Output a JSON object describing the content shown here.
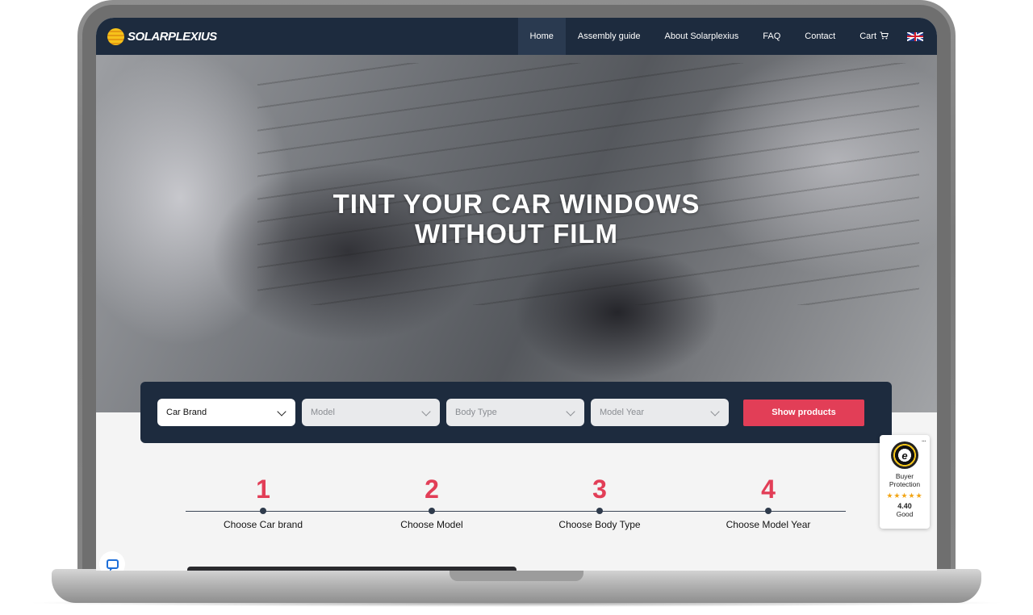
{
  "brand": {
    "name": "SOLARPLEXIUS"
  },
  "nav": {
    "items": [
      {
        "label": "Home",
        "active": true
      },
      {
        "label": "Assembly guide",
        "active": false
      },
      {
        "label": "About Solarplexius",
        "active": false
      },
      {
        "label": "FAQ",
        "active": false
      },
      {
        "label": "Contact",
        "active": false
      },
      {
        "label": "Cart",
        "active": false
      }
    ],
    "cart_icon": "shopping-cart-icon",
    "language_icon": "uk-flag-icon"
  },
  "hero": {
    "title_line1": "TINT YOUR CAR WINDOWS",
    "title_line2": "WITHOUT FILM"
  },
  "filter": {
    "selects": [
      {
        "label": "Car Brand",
        "enabled": true
      },
      {
        "label": "Model",
        "enabled": false
      },
      {
        "label": "Body Type",
        "enabled": false
      },
      {
        "label": "Model Year",
        "enabled": false
      }
    ],
    "button_label": "Show products"
  },
  "steps": [
    {
      "number": "1",
      "label": "Choose Car brand"
    },
    {
      "number": "2",
      "label": "Choose Model"
    },
    {
      "number": "3",
      "label": "Choose Body Type"
    },
    {
      "number": "4",
      "label": "Choose Model Year"
    }
  ],
  "trust_badge": {
    "menu": "...",
    "line1": "Buyer",
    "line2": "Protection",
    "stars": "★★★★★",
    "score": "4.40",
    "rating_word": "Good"
  },
  "colors": {
    "navy": "#1d2b3e",
    "accent_red": "#e23e57",
    "chat_blue": "#1e6fd9"
  }
}
